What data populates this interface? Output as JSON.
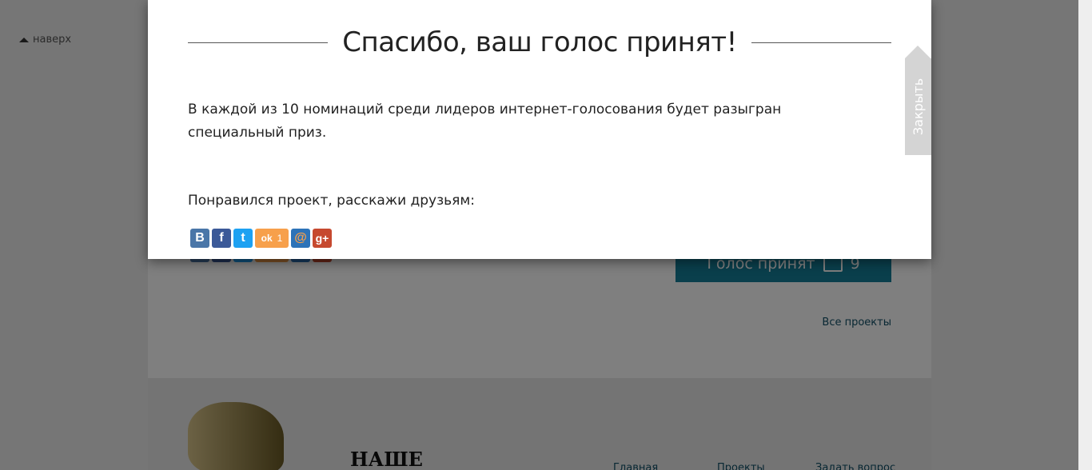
{
  "page": {
    "back_to_top": "наверх",
    "vote_button": "Голос принят",
    "vote_count": "9",
    "all_projects": "Все проекты",
    "brand": "НАШЕ",
    "footer_nav": [
      "Главная",
      "Проекты",
      "Задать вопрос"
    ]
  },
  "modal": {
    "title": "Спасибо, ваш голос принят!",
    "message": "В каждой из 10 номинаций среди лидеров интернет-голосования будет разыгран специальный приз.",
    "share_label": "Понравился проект, расскажи друзьям:",
    "share_buttons": [
      {
        "name": "vk",
        "glyph": "B",
        "color": "#4a76a8"
      },
      {
        "name": "facebook",
        "glyph": "f",
        "color": "#3b5998"
      },
      {
        "name": "twitter",
        "glyph": "t",
        "color": "#1da1f2"
      },
      {
        "name": "odnoklassniki",
        "glyph": "ok",
        "color": "#f7a04b",
        "count": "1"
      },
      {
        "name": "mailru",
        "glyph": "@",
        "color": "#2d73b8"
      },
      {
        "name": "googleplus",
        "glyph": "g+",
        "color": "#c6492f"
      }
    ],
    "close_label": "Закрыть"
  }
}
